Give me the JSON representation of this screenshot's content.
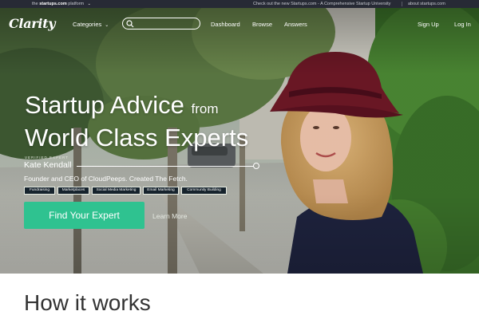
{
  "platform_bar": {
    "prefix": "the",
    "brand": "startups.com",
    "suffix": "platform",
    "promo": "Check out the new Startups.com - A Comprehensive Startup University",
    "about": "about startups.com"
  },
  "nav": {
    "logo": "Clarity",
    "categories": "Categories",
    "search_placeholder": "",
    "links": [
      "Dashboard",
      "Browse",
      "Answers"
    ],
    "sign_up": "Sign Up",
    "log_in": "Log In"
  },
  "hero": {
    "headline_line1": "Startup Advice",
    "headline_from": "from",
    "headline_line2": "World Class Experts",
    "expert_label": "VERIFIED EXPERT",
    "expert_name": "Kate Kendall",
    "expert_description": "Founder and CEO of CloudPeeps. Created The Fetch.",
    "tags": [
      "Fundraising",
      "Marketplaces",
      "Social Media Marketing",
      "Email Marketing",
      "Community Building"
    ],
    "cta": "Find Your Expert",
    "learn_more": "Learn More"
  },
  "how_it_works": {
    "title": "How it works"
  },
  "colors": {
    "accent": "#2fc290",
    "platform_bar": "#272a35",
    "hat": "#6e1826",
    "sweater": "#1f2440"
  },
  "icons": {
    "search": "search-icon",
    "caret": "chevron-down-icon"
  }
}
